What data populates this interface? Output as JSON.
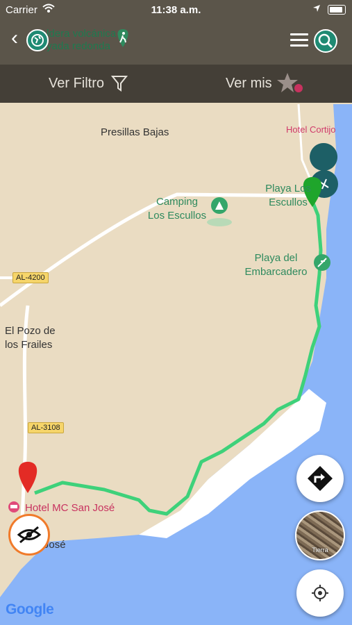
{
  "status": {
    "carrier": "Carrier",
    "time": "11:38 a.m."
  },
  "header": {
    "title_line1": "Caldera volcánica",
    "title_line2": "Hoyada redonda",
    "accent_color": "#1f8a73"
  },
  "filterbar": {
    "filter_label": "Ver Filtro",
    "favorites_label": "Ver mis",
    "hotel_label": "Hotel Cortijo"
  },
  "map": {
    "labels": {
      "presillas": "Presillas Bajas",
      "camping_1": "Camping",
      "camping_2": "Los Escullos",
      "playa_escullos_1": "Playa Los",
      "playa_escullos_2": "Escullos",
      "playa_emb_1": "Playa del",
      "playa_emb_2": "Embarcadero",
      "pozo_1": "El Pozo de",
      "pozo_2": "los Frailes",
      "hotel": "Hotel MC San José",
      "san_jose": "San José"
    },
    "road_badges": {
      "al4200": "AL-4200",
      "al3108": "AL-3108"
    },
    "route_color": "#3ed17a",
    "sea_color": "#8ab4f8",
    "land_color": "#eadcc2"
  },
  "controls": {
    "earth_label": "Tierra",
    "attribution": "Google"
  },
  "icons": [
    "back-icon",
    "globe-icon",
    "hiker-icon",
    "menu-icon",
    "search-icon",
    "filter-icon",
    "star-icon",
    "directions-icon",
    "locate-icon",
    "hide-icon",
    "pin-icon"
  ]
}
